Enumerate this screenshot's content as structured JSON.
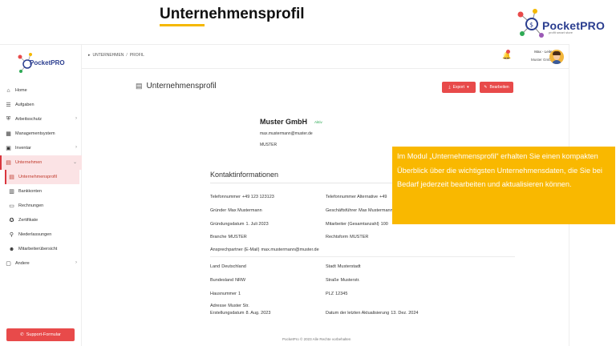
{
  "slide": {
    "title": "Unternehmensprofil",
    "brand_name": "PocketPRO",
    "brand_tagline": "profit smart store"
  },
  "sidebar": {
    "logo_text": "PocketPRO",
    "items": [
      {
        "label": "Home",
        "icon": "home-icon"
      },
      {
        "label": "Aufgaben",
        "icon": "list-icon"
      },
      {
        "label": "Arbeitsschutz",
        "icon": "shield-icon",
        "expandable": true
      },
      {
        "label": "Managementsystem",
        "icon": "grid-icon"
      },
      {
        "label": "Inventar",
        "icon": "box-icon",
        "expandable": true
      },
      {
        "label": "Unternehmen",
        "icon": "building-icon",
        "expandable": true,
        "open": true
      }
    ],
    "sub_items": [
      {
        "label": "Unternehmensprofil",
        "icon": "building-icon",
        "active": true
      },
      {
        "label": "Bankkonten",
        "icon": "bank-icon"
      },
      {
        "label": "Rechnungen",
        "icon": "invoice-icon"
      },
      {
        "label": "Zertifikate",
        "icon": "certificate-icon"
      },
      {
        "label": "Niederlassungen",
        "icon": "branch-icon"
      },
      {
        "label": "Mitarbeiterübersicht",
        "icon": "users-icon"
      }
    ],
    "other": {
      "label": "Andere",
      "icon": "folder-icon"
    },
    "support_label": "Support-Formular"
  },
  "topbar": {
    "breadcrumb": [
      "UNTERNEHMEN",
      "PROFIL"
    ],
    "breadcrumb_sep": "/",
    "notifications": "1",
    "user_name": "Max - Leiter",
    "user_company": "Muster GmbH"
  },
  "page": {
    "title": "Unternehmensprofil",
    "export_label": "Export",
    "edit_label": "Bearbeiten"
  },
  "company": {
    "name": "Muster GmbH",
    "status": "Aktiv",
    "email": "max.mustermann@muster.de",
    "short": "MUSTER"
  },
  "contact": {
    "title": "Kontaktinformationen",
    "phone": {
      "label": "Telefonnummer",
      "value": "+49 123 123123"
    },
    "phone_alt": {
      "label": "Telefonnummer Alternative",
      "value": "+49"
    },
    "founder": {
      "label": "Gründer",
      "value": "Max Mustermann"
    },
    "ceo": {
      "label": "Geschäftsführer",
      "value": "Max Mustermann"
    },
    "founded": {
      "label": "Gründungsdatum",
      "value": "1. Juli 2023"
    },
    "employees": {
      "label": "Mitarbeiter (Gesamtanzahl)",
      "value": "100"
    },
    "branch": {
      "label": "Branche",
      "value": "MUSTER"
    },
    "legal_form": {
      "label": "Rechtsform",
      "value": "MUSTER"
    },
    "contact_person": {
      "label": "Ansprechpartner (E-Mail)",
      "value": "max.mustermann@muster.de"
    },
    "country": {
      "label": "Land",
      "value": "Deutschland"
    },
    "city": {
      "label": "Stadt",
      "value": "Musterstadt"
    },
    "state": {
      "label": "Bundesland",
      "value": "NRW"
    },
    "street": {
      "label": "Straße",
      "value": "Musterstr."
    },
    "house_no": {
      "label": "Hausnummer",
      "value": "1"
    },
    "zip": {
      "label": "PLZ",
      "value": "12345"
    },
    "address": {
      "label": "Adresse",
      "value": "Muster Str."
    },
    "created": {
      "label": "Erstellungsdatum",
      "value": "8. Aug. 2023"
    },
    "updated": {
      "label": "Datum der letzten Aktualisierung",
      "value": "13. Dez. 2024"
    }
  },
  "footer": "PocketPro © 2023 Alle Rechte vorbehalten",
  "callout": "Im Modul „Unternehmensprofil“ erhalten Sie einen kompakten Überblick über die wichtigsten Unternehmensdaten, die Sie bei Bedarf jederzeit bearbeiten und aktualisieren können.",
  "colors": {
    "accent": "#e84a4a",
    "callout": "#f9b800",
    "status": "#2eaa55"
  }
}
